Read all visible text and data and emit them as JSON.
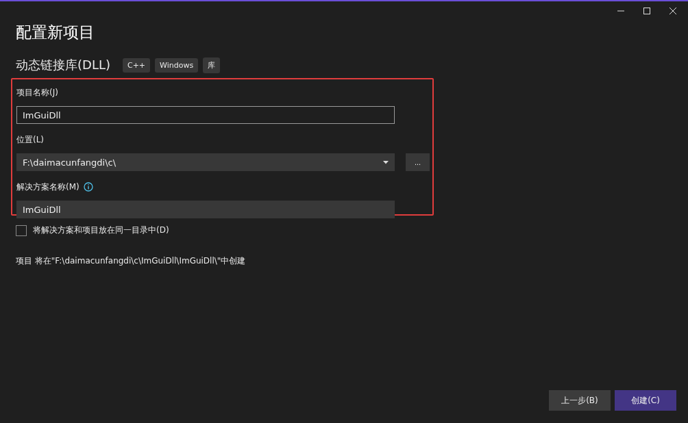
{
  "window": {
    "title": "配置新项目"
  },
  "template": {
    "name": "动态链接库(DLL)",
    "tags": [
      "C++",
      "Windows",
      "库"
    ]
  },
  "fields_group": {
    "highlighted": true,
    "fields": [
      {
        "kind": "text",
        "label": "项目名称(J)",
        "value": "ImGuiDll",
        "focused": true,
        "info": false
      },
      {
        "kind": "dropdown",
        "label": "位置(L)",
        "value": "F:\\daimacunfangdi\\c\\",
        "focused": false,
        "info": false,
        "browse": "..."
      },
      {
        "kind": "text",
        "label": "解决方案名称(M)",
        "value": "ImGuiDll",
        "focused": false,
        "info": true
      }
    ]
  },
  "same_dir": {
    "label": "将解决方案和项目放在同一目录中(D)",
    "checked": false
  },
  "summary": "项目 将在\"F:\\daimacunfangdi\\c\\ImGuiDll\\ImGuiDll\\\"中创建",
  "buttons": [
    {
      "label": "上一步(B)",
      "primary": false
    },
    {
      "label": "创建(C)",
      "primary": true
    }
  ]
}
